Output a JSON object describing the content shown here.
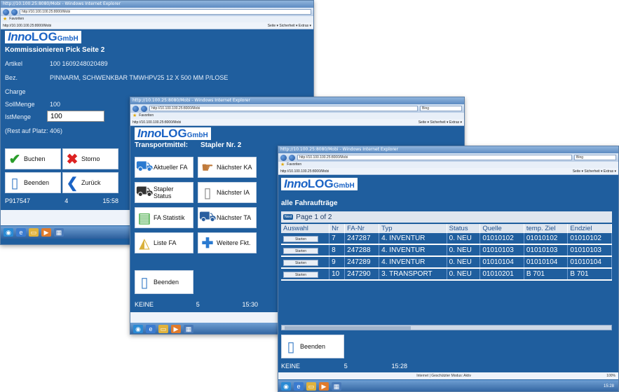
{
  "window1": {
    "title": "http://10.100.25:8080/Mobi - Windows Internet Explorer",
    "address": "http://10.100.100.25:8000/Mobi",
    "favorites": "Favoriten",
    "tab": "http://10.100.100.25:8000/Mobi",
    "tab_tools": "Seite ▾  Sicherheit ▾  Extras ▾",
    "logo_inno": "Inno",
    "logo_log": "LOG",
    "logo_gmbh": "GmbH",
    "header": "Kommissionieren Pick Seite 2",
    "artikel_label": "Artikel",
    "artikel_value": "100  1609248020489",
    "bez_label": "Bez.",
    "bez_value": "PINNARM, SCHWENKBAR TMWHPV25 12 X 500 MM P/LOSE",
    "charge_label": "Charge",
    "soll_label": "SollMenge",
    "soll_value": "100",
    "ist_label": "IstMenge",
    "ist_value": "100",
    "rest": "(Rest auf Platz: 406)",
    "buttons": {
      "buchen": "Buchen",
      "storno": "Storno",
      "beenden": "Beenden",
      "zurueck": "Zurück"
    },
    "status": {
      "user": "P917547",
      "num": "4",
      "time": "15:58"
    }
  },
  "window2": {
    "title": "http://10.100.25:8080/Mobi - Windows Internet Explorer",
    "address": "http://10.100.100.25:8000/Mobi",
    "search": "Bing",
    "favorites": "Favoriten",
    "tab": "http://10.100.100.25:8000/Mobi",
    "tab_tools": "Seite ▾  Sicherheit ▾  Extras ▾",
    "logo_inno": "Inno",
    "logo_log": "LOG",
    "logo_gmbh": "GmbH",
    "transport_label": "Transportmittel:",
    "transport_value": "Stapler Nr. 2",
    "buttons": {
      "aktueller_fa": "Aktueller FA",
      "naechster_ka": "Nächster KA",
      "stapler_status": "Stapler Status",
      "naechster_ia": "Nächster IA",
      "fa_statistik": "FA Statistik",
      "naechster_ta": "Nächster TA",
      "liste_fa": "Liste FA",
      "weitere_fkt": "Weitere Fkt.",
      "beenden": "Beenden"
    },
    "status": {
      "user": "KEINE",
      "num": "5",
      "time": "15:30"
    }
  },
  "window3": {
    "title": "http://10.100.25:8080/Mobi - Windows Internet Explorer",
    "address": "http://10.100.100.25:8000/Mobi",
    "search": "Bing",
    "favorites": "Favoriten",
    "tab": "http://10.100.100.25:8000/Mobi",
    "tab_tools": "Seite ▾  Sicherheit ▾  Extras ▾",
    "logo_inno": "Inno",
    "logo_log": "LOG",
    "logo_gmbh": "GmbH",
    "header": "alle Fahraufträge",
    "next_label": "Next",
    "page_label": "Page 1 of 2",
    "columns": [
      "Auswahl",
      "Nr",
      "FA-Nr",
      "Typ",
      "Status",
      "Quelle",
      "temp. Ziel",
      "Endziel"
    ],
    "select_label": "Starten",
    "rows": [
      {
        "nr": "7",
        "fa": "247287",
        "typ": "4. INVENTUR",
        "status": "0. NEU",
        "quelle": "01010102",
        "temp": "01010102",
        "end": "01010102"
      },
      {
        "nr": "8",
        "fa": "247288",
        "typ": "4. INVENTUR",
        "status": "0. NEU",
        "quelle": "01010103",
        "temp": "01010103",
        "end": "01010103"
      },
      {
        "nr": "9",
        "fa": "247289",
        "typ": "4. INVENTUR",
        "status": "0. NEU",
        "quelle": "01010104",
        "temp": "01010104",
        "end": "01010104"
      },
      {
        "nr": "10",
        "fa": "247290",
        "typ": "3. TRANSPORT",
        "status": "0. NEU",
        "quelle": "01010201",
        "temp": "B 701",
        "end": "B 701"
      }
    ],
    "beenden": "Beenden",
    "status": {
      "user": "KEINE",
      "num": "5",
      "time": "15:28"
    },
    "ie_status": "Internet | Geschützter Modus: Aktiv",
    "zoom": "100%",
    "clock": "15:28"
  },
  "colors": {
    "app_bg": "#1f5e9e",
    "logo": "#1a63c5",
    "grid_header": "#dfe6ef"
  }
}
